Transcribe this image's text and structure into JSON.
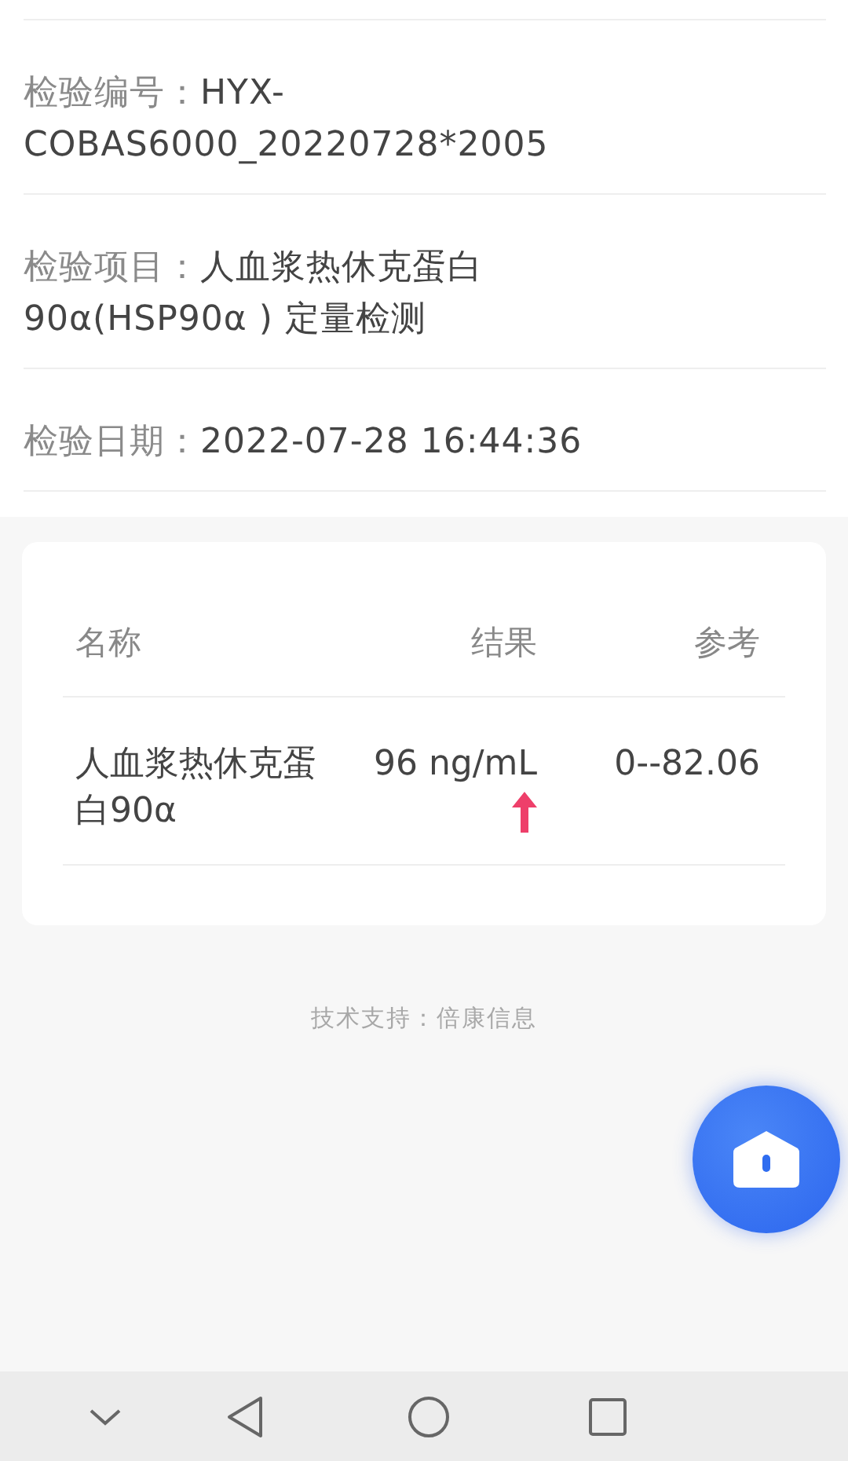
{
  "info_fields": [
    {
      "label": "检验编号：",
      "value": "HYX-COBAS6000_20220728*2005"
    },
    {
      "label": "检验项目：",
      "value": "人血浆热休克蛋白90α(HSP90α ) 定量检测"
    },
    {
      "label": "检验日期：",
      "value": "2022-07-28 16:44:36"
    }
  ],
  "table": {
    "columns": [
      "名称",
      "结果",
      "参考"
    ],
    "rows": [
      {
        "name": "人血浆热休克蛋白90α",
        "result": "96 ng/mL",
        "high": true,
        "reference": "0--82.06"
      }
    ]
  },
  "footer": "技术支持：倍康信息"
}
